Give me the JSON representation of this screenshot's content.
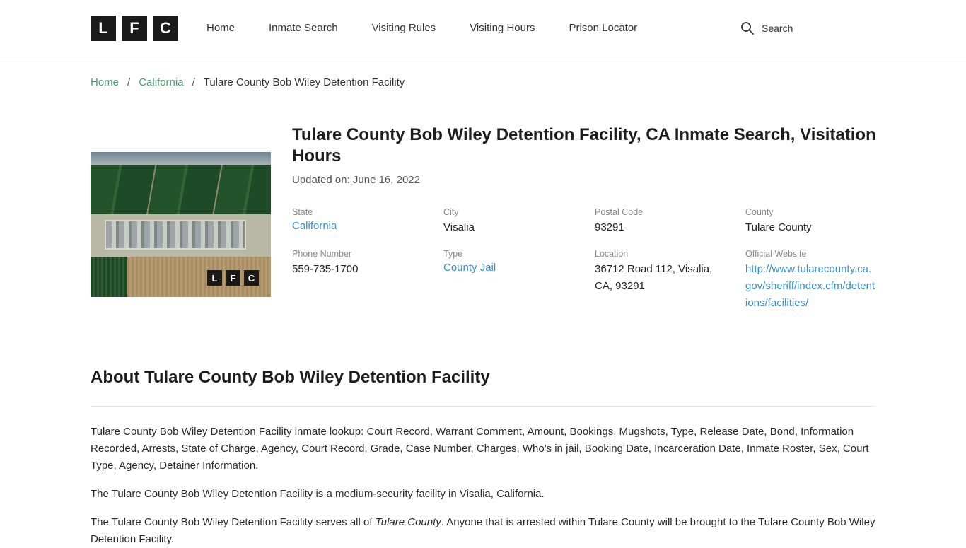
{
  "header": {
    "logo_letters": [
      "L",
      "F",
      "C"
    ],
    "nav": [
      {
        "label": "Home"
      },
      {
        "label": "Inmate Search"
      },
      {
        "label": "Visiting Rules"
      },
      {
        "label": "Visiting Hours"
      },
      {
        "label": "Prison Locator"
      }
    ],
    "search_label": "Search",
    "search_icon": "search-icon"
  },
  "breadcrumb": {
    "items": [
      {
        "label": "Home"
      },
      {
        "label": "California"
      }
    ],
    "separator": "/",
    "current": "Tulare County Bob Wiley Detention Facility"
  },
  "facility": {
    "image_logo_letters": [
      "L",
      "F",
      "C"
    ],
    "title": "Tulare County Bob Wiley Detention Facility, CA Inmate Search, Visitation Hours",
    "updated": "Updated on: June 16, 2022",
    "info": {
      "state": {
        "label": "State",
        "value": "California"
      },
      "city": {
        "label": "City",
        "value": "Visalia"
      },
      "postal_code": {
        "label": "Postal Code",
        "value": "93291"
      },
      "county": {
        "label": "County",
        "value": "Tulare County"
      },
      "phone": {
        "label": "Phone Number",
        "value": "559-735-1700"
      },
      "type": {
        "label": "Type",
        "value": "County Jail"
      },
      "location": {
        "label": "Location",
        "value": "36712 Road 112, Visalia, CA, 93291"
      },
      "website": {
        "label": "Official Website",
        "value": "http://www.tularecounty.ca.gov/sheriff/index.cfm/detentions/facilities/"
      }
    }
  },
  "about": {
    "title": "About Tulare County Bob Wiley Detention Facility",
    "p1": "Tulare County Bob Wiley Detention Facility inmate lookup: Court Record, Warrant Comment, Amount, Bookings, Mugshots, Type, Release Date, Bond, Information Recorded, Arrests, State of Charge, Agency, Court Record, Grade, Case Number, Charges, Who's in jail, Booking Date, Incarceration Date, Inmate Roster, Sex, Court Type, Agency, Detainer Information.",
    "p2": "The Tulare County Bob Wiley Detention Facility is a medium-security facility in Visalia, California.",
    "p3_before": "The Tulare County Bob Wiley Detention Facility serves all of ",
    "p3_em": "Tulare County",
    "p3_after": ". Anyone that is arrested within Tulare County will be brought to the Tulare County Bob Wiley Detention Facility."
  }
}
